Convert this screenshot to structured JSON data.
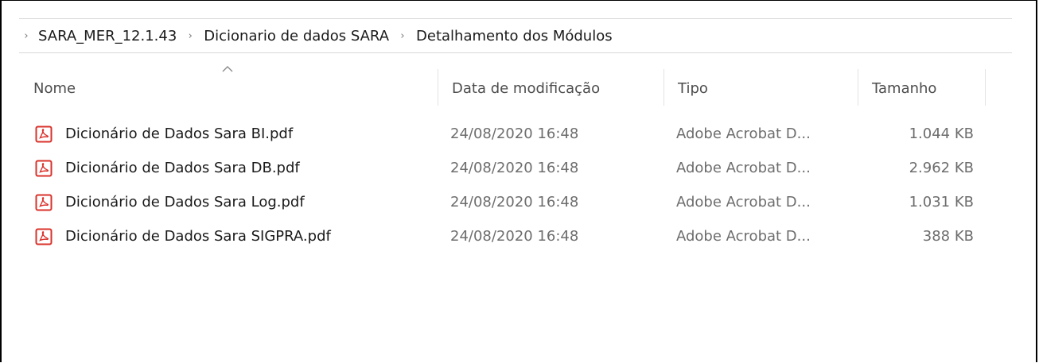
{
  "breadcrumb": {
    "segments": [
      "SARA_MER_12.1.43",
      "Dicionario de dados SARA",
      "Detalhamento dos Módulos"
    ]
  },
  "columns": {
    "name": "Nome",
    "date": "Data de modificação",
    "type": "Tipo",
    "size": "Tamanho",
    "sort_indicator": "sort-ascending-caret-icon"
  },
  "files": [
    {
      "name": "Dicionário de Dados Sara BI.pdf",
      "date": "24/08/2020 16:48",
      "type": "Adobe Acrobat D...",
      "size": "1.044 KB",
      "icon": "pdf-icon"
    },
    {
      "name": "Dicionário de Dados Sara DB.pdf",
      "date": "24/08/2020 16:48",
      "type": "Adobe Acrobat D...",
      "size": "2.962 KB",
      "icon": "pdf-icon"
    },
    {
      "name": "Dicionário de Dados Sara Log.pdf",
      "date": "24/08/2020 16:48",
      "type": "Adobe Acrobat D...",
      "size": "1.031 KB",
      "icon": "pdf-icon"
    },
    {
      "name": "Dicionário de Dados Sara SIGPRA.pdf",
      "date": "24/08/2020 16:48",
      "type": "Adobe Acrobat D...",
      "size": "388 KB",
      "icon": "pdf-icon"
    }
  ],
  "colors": {
    "pdf_icon": "#d9322b",
    "header_text": "#4d4d4d",
    "meta_text": "#6d6d6d"
  }
}
